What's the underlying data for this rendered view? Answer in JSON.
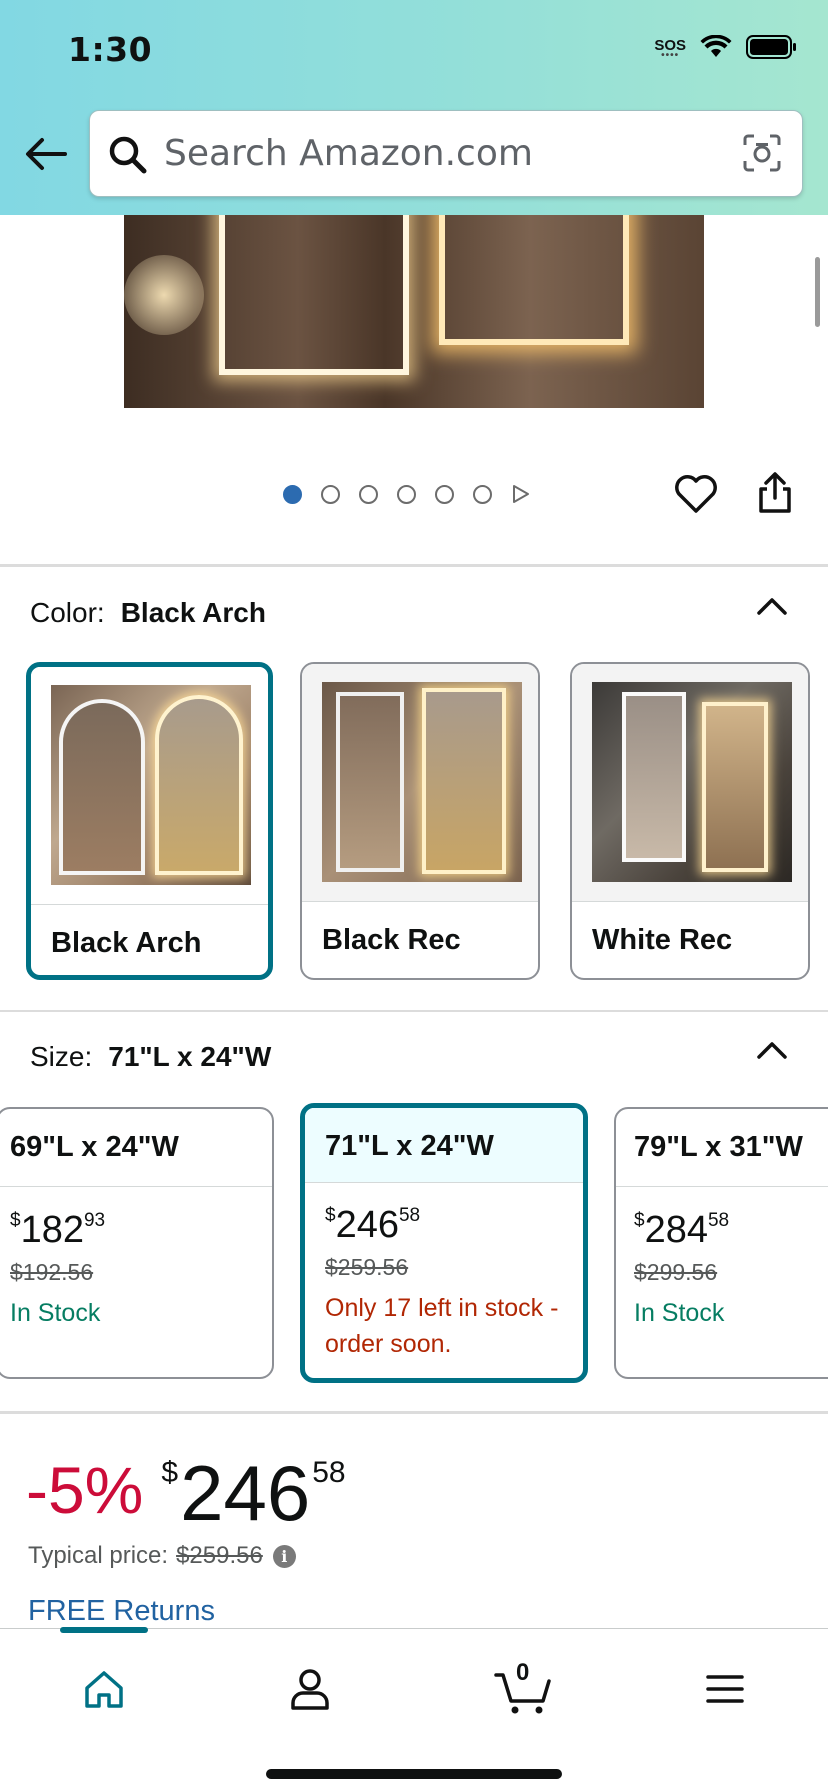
{
  "status_bar": {
    "time": "1:30",
    "sos": "SOS"
  },
  "search": {
    "placeholder": "Search Amazon.com"
  },
  "gallery": {
    "page_count": 6,
    "active_page": 1
  },
  "color_section": {
    "label": "Color:",
    "selected_value": "Black Arch",
    "options": [
      {
        "label": "Black Arch",
        "selected": true
      },
      {
        "label": "Black Rec",
        "selected": false
      },
      {
        "label": "White Rec",
        "selected": false
      }
    ]
  },
  "size_section": {
    "label": "Size:",
    "selected_value": "71\"L x 24\"W",
    "options": [
      {
        "label": "69\"L x 24\"W",
        "price_symbol": "$",
        "price_whole": "182",
        "price_fraction": "93",
        "list_price": "$192.56",
        "stock": "In Stock",
        "stock_color": "#067d62",
        "selected": false
      },
      {
        "label": "71\"L x 24\"W",
        "price_symbol": "$",
        "price_whole": "246",
        "price_fraction": "58",
        "list_price": "$259.56",
        "stock": "Only 17 left in stock - order soon.",
        "stock_color": "#b12704",
        "selected": true
      },
      {
        "label": "79\"L x 31\"W",
        "price_symbol": "$",
        "price_whole": "284",
        "price_fraction": "58",
        "list_price": "$299.56",
        "stock": "In Stock",
        "stock_color": "#067d62",
        "selected": false
      }
    ]
  },
  "price": {
    "discount": "-5%",
    "symbol": "$",
    "whole": "246",
    "fraction": "58",
    "typical_label": "Typical price:",
    "typical_value": "$259.56",
    "info_glyph": "i",
    "free_returns": "FREE Returns"
  },
  "bottom_nav": {
    "items": [
      "home-icon",
      "account-icon",
      "cart-icon",
      "menu-icon"
    ],
    "cart_count": "0",
    "active": "home"
  },
  "colors": {
    "accent_teal": "#007185",
    "discount_red": "#cc0c39",
    "link_blue": "#2162a1",
    "pager_active": "#2c6bb0"
  }
}
